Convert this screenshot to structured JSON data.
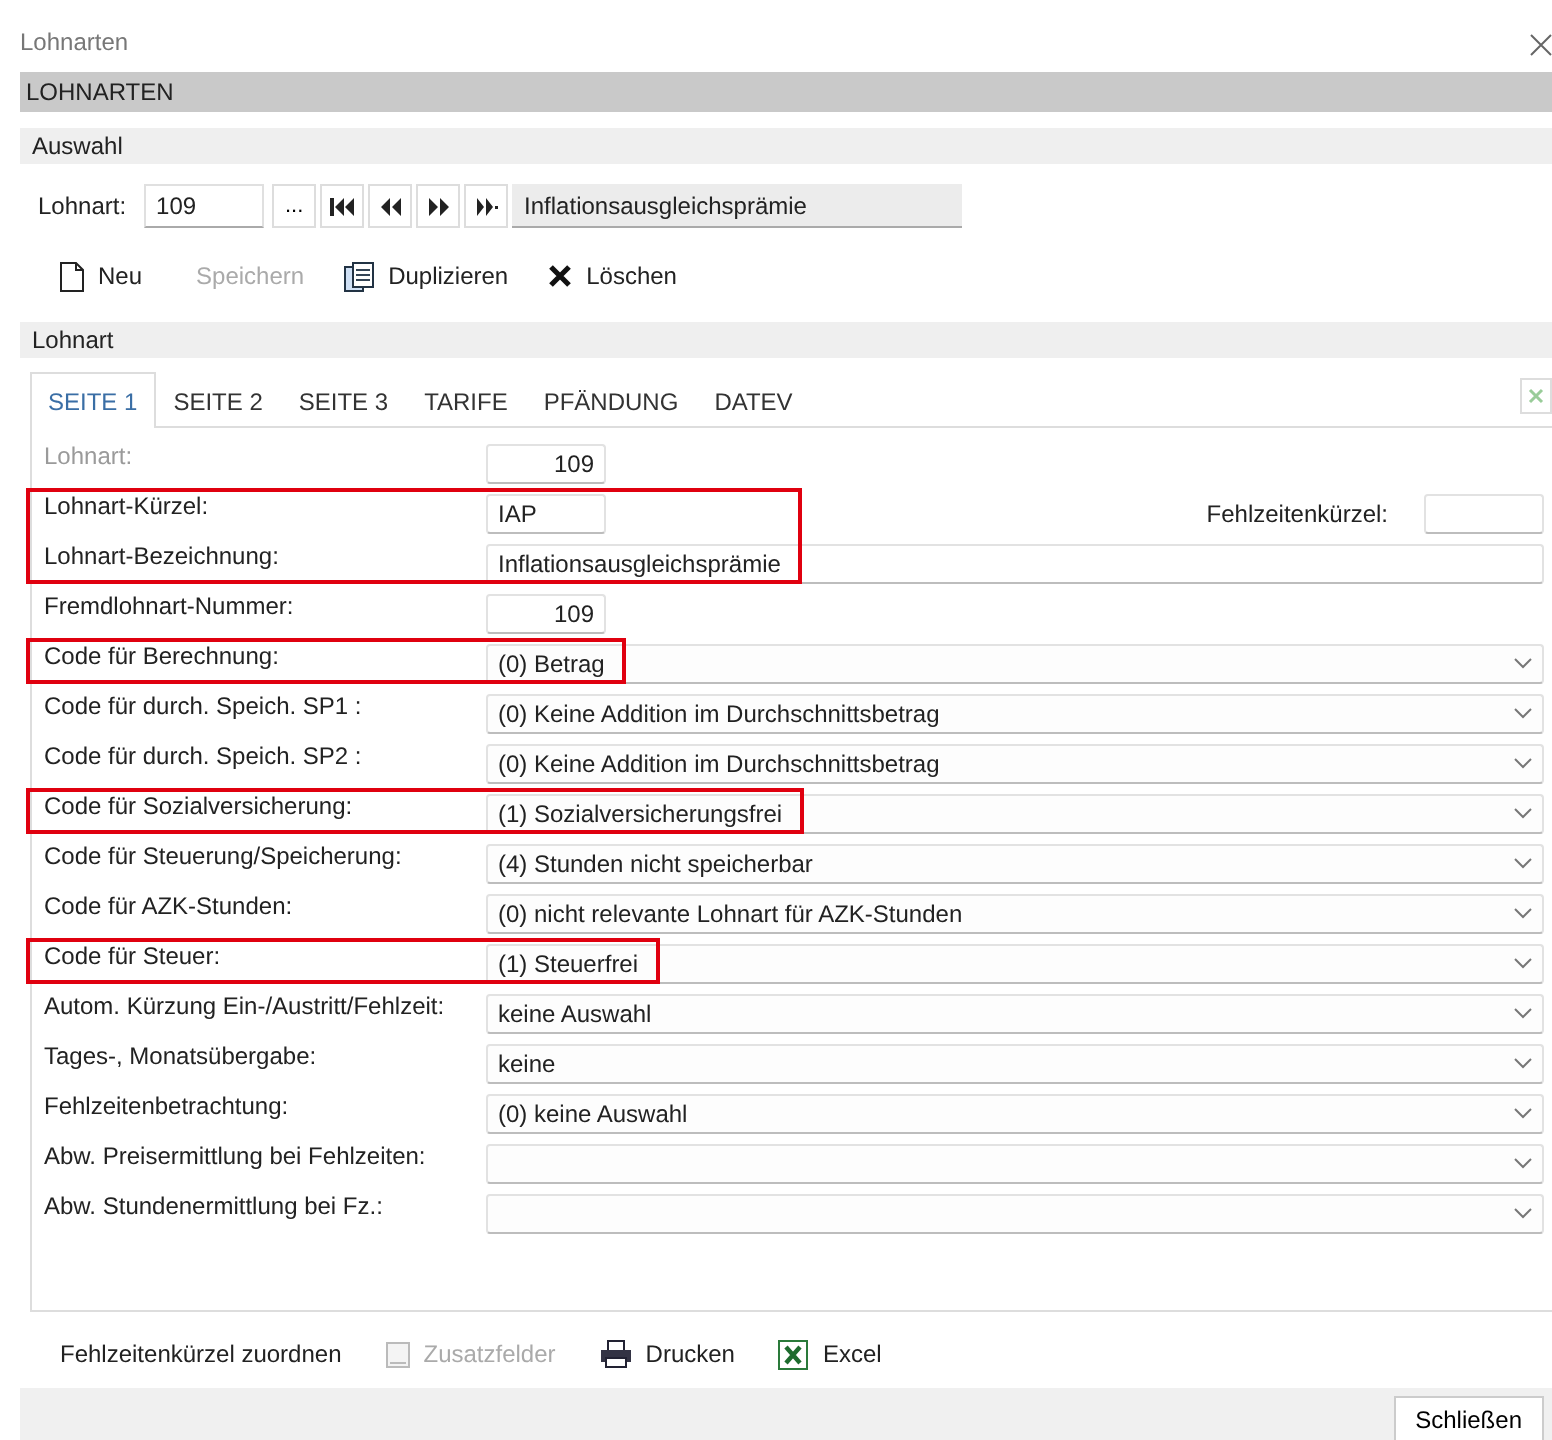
{
  "window": {
    "title": "Lohnarten"
  },
  "header": "LOHNARTEN",
  "selection": {
    "title": "Auswahl",
    "label": "Lohnart:",
    "value": "109",
    "nav_buttons": [
      {
        "kind": "browse",
        "text": "..."
      },
      {
        "kind": "first"
      },
      {
        "kind": "prev"
      },
      {
        "kind": "next"
      },
      {
        "kind": "last"
      }
    ],
    "name": "Inflationsausgleichsprämie"
  },
  "toolbar": [
    {
      "kind": "new",
      "label": "Neu",
      "disabled": false
    },
    {
      "kind": "save",
      "label": "Speichern",
      "disabled": true
    },
    {
      "kind": "duplicate",
      "label": "Duplizieren",
      "disabled": false
    },
    {
      "kind": "delete",
      "label": "Löschen",
      "disabled": false
    }
  ],
  "section": {
    "title": "Lohnart"
  },
  "tabs": [
    {
      "label": "SEITE 1",
      "selected": true
    },
    {
      "label": "SEITE 2",
      "selected": false
    },
    {
      "label": "SEITE 3",
      "selected": false
    },
    {
      "label": "TARIFE",
      "selected": false
    },
    {
      "label": "PFÄNDUNG",
      "selected": false
    },
    {
      "label": "DATEV",
      "selected": false
    }
  ],
  "fields": [
    {
      "kind": "number",
      "label": "Lohnart:",
      "value": "109",
      "disabled": true
    },
    {
      "kind": "highlight",
      "rows": [
        {
          "kind": "short",
          "label": "Lohnart-Kürzel:",
          "value": "IAP",
          "disabled": false,
          "extra": {
            "label": "Fehlzeitenkürzel:"
          }
        },
        {
          "kind": "text",
          "label": "Lohnart-Bezeichnung:",
          "value": "Inflationsausgleichsprämie",
          "disabled": false
        }
      ]
    },
    {
      "kind": "number",
      "label": "Fremdlohnart-Nummer:",
      "value": "109",
      "disabled": false
    },
    {
      "kind": "highlight",
      "rows": [
        {
          "kind": "select",
          "label": "Code für Berechnung:",
          "value": "(0) Betrag",
          "disabled": false
        }
      ]
    },
    {
      "kind": "select",
      "label": "Code für durch. Speich. SP1 :",
      "value": "(0) Keine Addition im Durchschnittsbetrag",
      "disabled": false
    },
    {
      "kind": "select",
      "label": "Code für durch. Speich. SP2 :",
      "value": "(0) Keine Addition im Durchschnittsbetrag",
      "disabled": false
    },
    {
      "kind": "highlight",
      "rows": [
        {
          "kind": "select",
          "label": "Code für Sozialversicherung:",
          "value": "(1) Sozialversicherungsfrei",
          "disabled": false
        }
      ]
    },
    {
      "kind": "select",
      "label": "Code für Steuerung/Speicherung:",
      "value": "(4) Stunden nicht speicherbar",
      "disabled": false
    },
    {
      "kind": "select",
      "label": "Code für AZK-Stunden:",
      "value": "(0) nicht relevante Lohnart für AZK-Stunden",
      "disabled": false
    },
    {
      "kind": "highlight",
      "rows": [
        {
          "kind": "select",
          "label": "Code für Steuer:",
          "value": "(1) Steuerfrei",
          "disabled": false
        }
      ]
    },
    {
      "kind": "select",
      "label": "Autom. Kürzung Ein-/Austritt/Fehlzeit:",
      "value": "keine Auswahl",
      "disabled": false
    },
    {
      "kind": "select",
      "label": "Tages-, Monatsübergabe:",
      "value": "keine",
      "disabled": false
    },
    {
      "kind": "select",
      "label": "Fehlzeitenbetrachtung:",
      "value": "(0) keine Auswahl",
      "disabled": false
    },
    {
      "kind": "select",
      "label": "Abw. Preisermittlung bei Fehlzeiten:",
      "disabled": false
    },
    {
      "kind": "select",
      "label": "Abw. Stundenermittlung bei Fz.:",
      "disabled": false
    }
  ],
  "bottom_toolbar": [
    {
      "kind": "plain",
      "label": "Fehlzeitenkürzel zuordnen",
      "disabled": false
    },
    {
      "kind": "fields",
      "label": "Zusatzfelder",
      "disabled": true
    },
    {
      "kind": "print",
      "label": "Drucken",
      "disabled": false
    },
    {
      "kind": "excel",
      "label": "Excel",
      "disabled": false
    }
  ],
  "footer": {
    "button": "Schließen"
  }
}
